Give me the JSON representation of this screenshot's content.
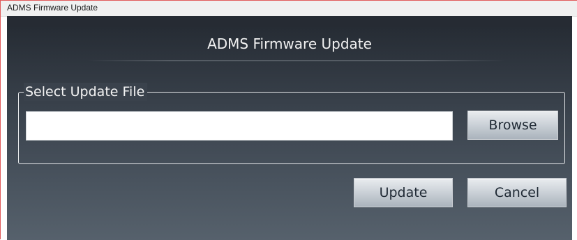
{
  "window": {
    "title": "ADMS Firmware Update"
  },
  "header": {
    "title": "ADMS Firmware Update"
  },
  "file_group": {
    "legend": "Select Update File",
    "file_path_value": "",
    "browse_label": "Browse"
  },
  "actions": {
    "update_label": "Update",
    "cancel_label": "Cancel"
  },
  "colors": {
    "client_top": "#262c34",
    "client_bottom": "#56616c",
    "button_face": "#cdd3d9",
    "text_light": "#f2f2f2"
  }
}
